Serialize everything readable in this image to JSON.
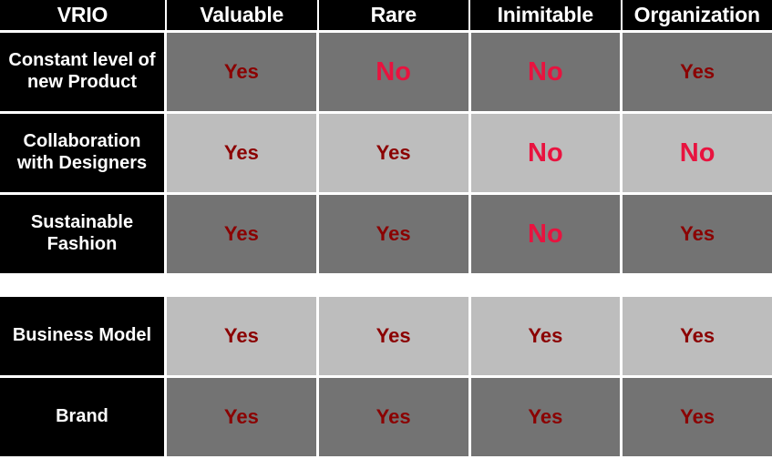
{
  "table": {
    "title": "VRIO",
    "columns": [
      {
        "key": "resource",
        "label": "VRIO"
      },
      {
        "key": "valuable",
        "label": "Valuable"
      },
      {
        "key": "rare",
        "label": "Rare"
      },
      {
        "key": "inimitable",
        "label": "Inimitable"
      },
      {
        "key": "organization",
        "label": "Organization"
      }
    ],
    "groups": [
      {
        "rows": [
          {
            "resource": "Constant level of new Product",
            "shade": "dark",
            "values": [
              "Yes",
              "No",
              "No",
              "Yes"
            ]
          },
          {
            "resource": "Collaboration with Designers",
            "shade": "light",
            "values": [
              "Yes",
              "Yes",
              "No",
              "No"
            ]
          },
          {
            "resource": "Sustainable Fashion",
            "shade": "dark",
            "values": [
              "Yes",
              "Yes",
              "No",
              "Yes"
            ]
          }
        ]
      },
      {
        "rows": [
          {
            "resource": "Business Model",
            "shade": "light",
            "values": [
              "Yes",
              "Yes",
              "Yes",
              "Yes"
            ]
          },
          {
            "resource": "Brand",
            "shade": "dark",
            "values": [
              "Yes",
              "Yes",
              "Yes",
              "Yes"
            ]
          }
        ]
      }
    ]
  },
  "colors": {
    "header_background": "#000000",
    "header_text": "#ffffff",
    "resource_background": "#000000",
    "resource_text": "#ffffff",
    "row_shade_dark": "#737373",
    "row_shade_light": "#bdbdbd",
    "yes_text": "#8b0000",
    "no_text": "#e8133f",
    "grid_line": "#ffffff"
  }
}
